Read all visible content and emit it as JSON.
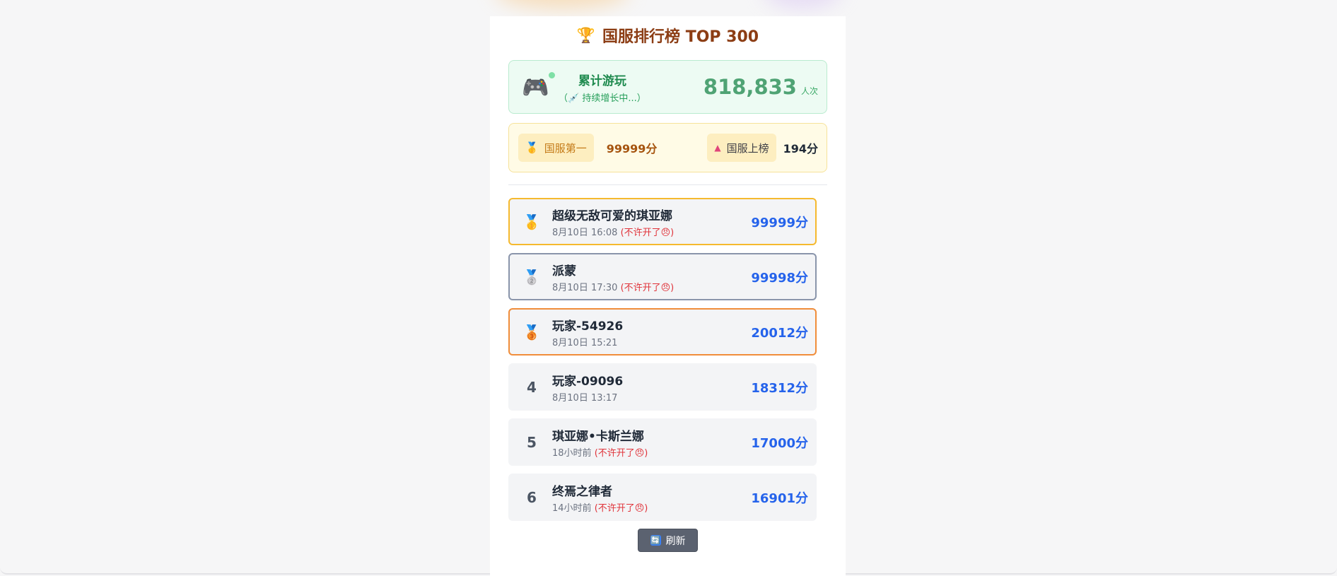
{
  "header": {
    "trophy_icon": "🏆",
    "title": "国服排行榜 TOP 300"
  },
  "play_stats": {
    "icon": "🎮",
    "label": "累计游玩",
    "sublabel": "（💉 持续增长中...）",
    "count": "818,833",
    "unit": "人次"
  },
  "score_info": {
    "first_icon": "🥇",
    "first_label": "国服第一",
    "first_score": "99999分",
    "rank_icon": "▲",
    "rank_label": "国服上榜",
    "rank_score": "194分"
  },
  "leaderboard": [
    {
      "rank": "1",
      "medal": "🥇",
      "name": "超级无敌可爱的琪亚娜",
      "time": "8月10日 16:08",
      "note": "(不许开了😠)",
      "score": "99999分"
    },
    {
      "rank": "2",
      "medal": "🥈",
      "name": "派蒙",
      "time": "8月10日 17:30",
      "note": "(不许开了😠)",
      "score": "99998分"
    },
    {
      "rank": "3",
      "medal": "🥉",
      "name": "玩家-54926",
      "time": "8月10日 15:21",
      "note": "",
      "score": "20012分"
    },
    {
      "rank": "4",
      "name": "玩家-09096",
      "time": "8月10日 13:17",
      "note": "",
      "score": "18312分"
    },
    {
      "rank": "5",
      "name": "琪亚娜•卡斯兰娜",
      "time": "18小时前",
      "note": "(不许开了😠)",
      "score": "17000分"
    },
    {
      "rank": "6",
      "name": "终焉之律者",
      "time": "14小时前",
      "note": "(不许开了😠)",
      "score": "16901分"
    }
  ],
  "actions": {
    "refresh_icon": "🔄",
    "refresh_label": "刷新"
  },
  "colors": {
    "title": "#8c3d14",
    "score": "#2563eb",
    "gold_border": "#f5b92e",
    "silver_border": "#8a95ab",
    "bronze_border": "#f08d3a",
    "note": "#e0333a"
  }
}
